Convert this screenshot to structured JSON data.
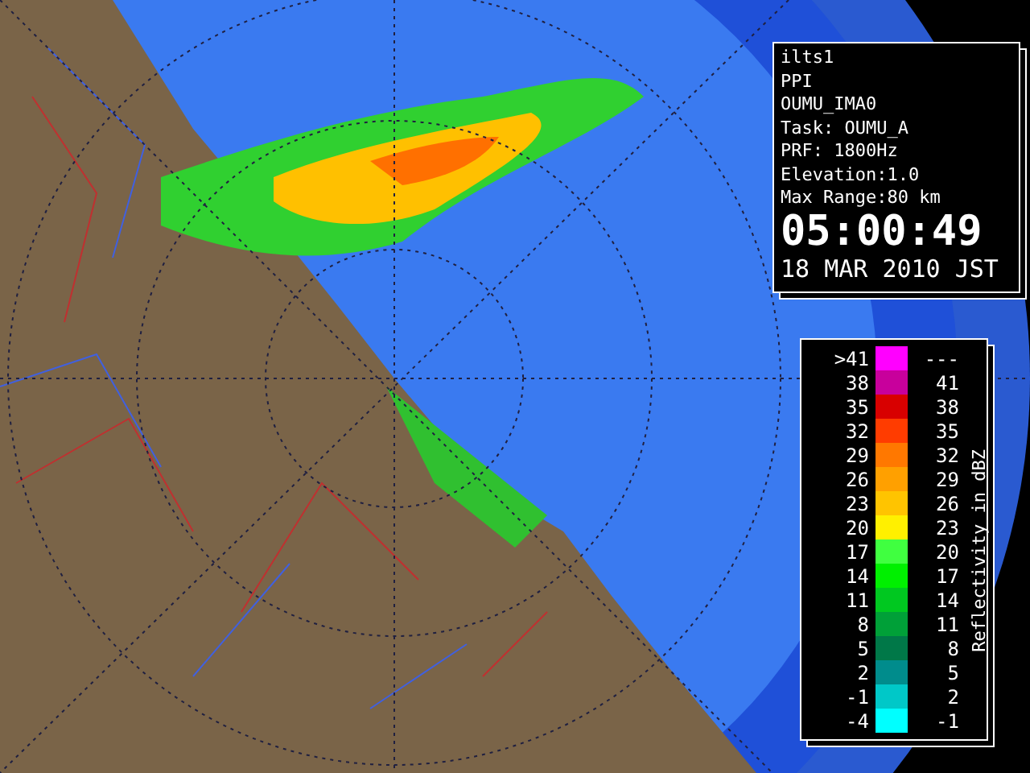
{
  "info": {
    "lines": [
      "ilts1",
      "PPI",
      "OUMU_IMA0",
      "Task: OUMU_A",
      "PRF: 1800Hz",
      "Elevation:1.0",
      "Max Range:80 km"
    ],
    "time": "05:00:49",
    "date": "18 MAR 2010 JST"
  },
  "legend": {
    "title": "Reflectivity in dBZ",
    "rows": [
      {
        "low": ">41",
        "high": "---",
        "color": "#ff00ff"
      },
      {
        "low": "38",
        "high": "41",
        "color": "#c8009c"
      },
      {
        "low": "35",
        "high": "38",
        "color": "#d80000"
      },
      {
        "low": "32",
        "high": "35",
        "color": "#ff3c00"
      },
      {
        "low": "29",
        "high": "32",
        "color": "#ff7800"
      },
      {
        "low": "26",
        "high": "29",
        "color": "#ffa000"
      },
      {
        "low": "23",
        "high": "26",
        "color": "#ffc400"
      },
      {
        "low": "20",
        "high": "23",
        "color": "#fff000"
      },
      {
        "low": "17",
        "high": "20",
        "color": "#40ff40"
      },
      {
        "low": "14",
        "high": "17",
        "color": "#00f000"
      },
      {
        "low": "11",
        "high": "14",
        "color": "#00c820"
      },
      {
        "low": "8",
        "high": "11",
        "color": "#00a038"
      },
      {
        "low": "5",
        "high": "8",
        "color": "#007848"
      },
      {
        "low": "2",
        "high": "5",
        "color": "#008c8c"
      },
      {
        "low": "-1",
        "high": "2",
        "color": "#00c8c8"
      },
      {
        "low": "-4",
        "high": "-1",
        "color": "#00ffff"
      }
    ]
  }
}
